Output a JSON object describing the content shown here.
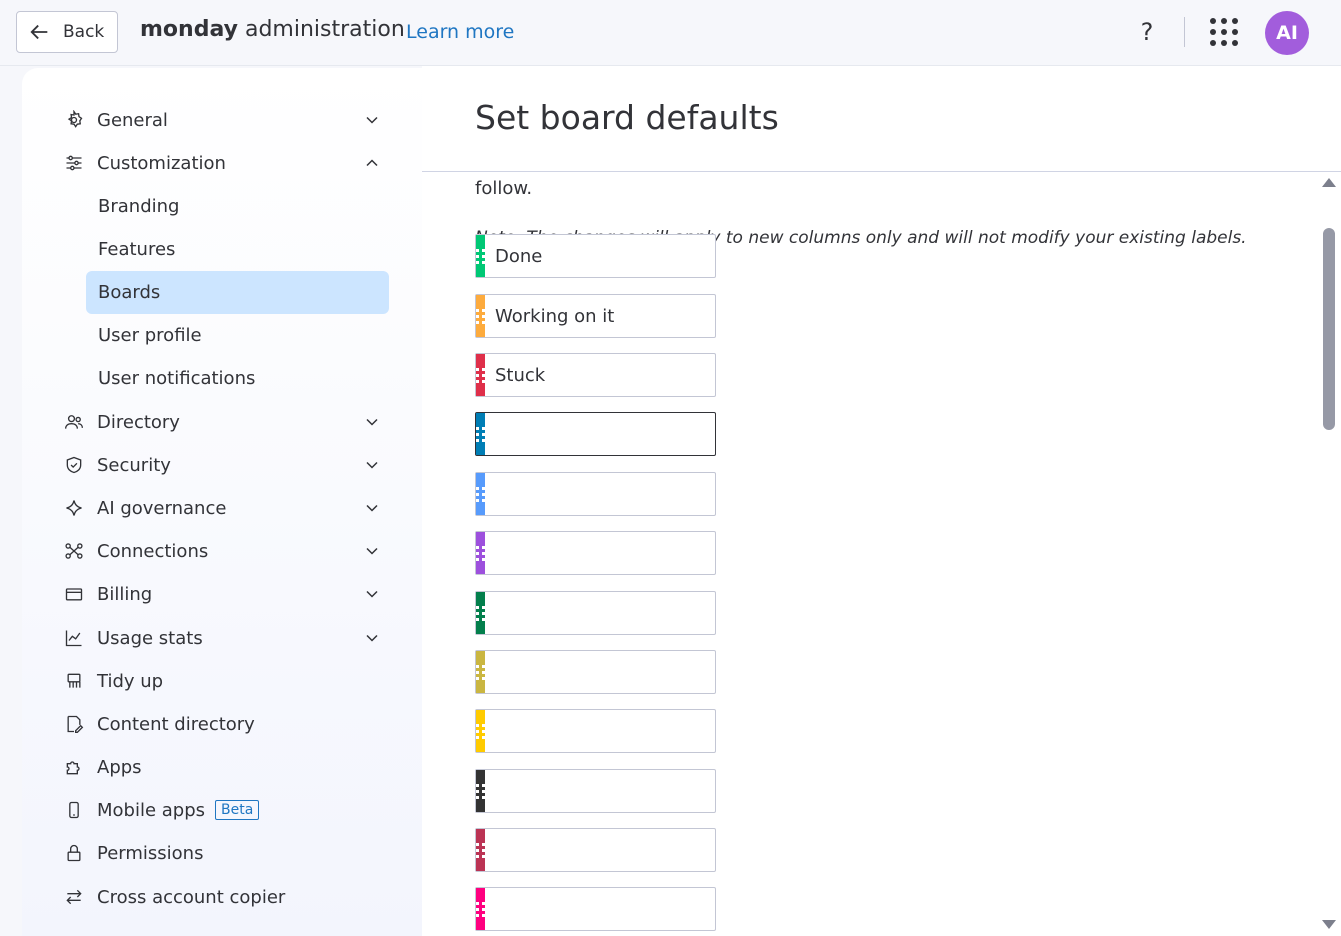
{
  "topbar": {
    "back_label": "Back",
    "brand_bold": "monday",
    "brand_rest": "administration",
    "learn_more": "Learn more",
    "help": "?",
    "avatar_initials": "AI",
    "avatar_color": "#a25ddc"
  },
  "sidebar": {
    "general": "General",
    "customization": "Customization",
    "branding": "Branding",
    "features": "Features",
    "boards": "Boards",
    "user_profile": "User profile",
    "user_notifications": "User notifications",
    "directory": "Directory",
    "security": "Security",
    "ai_governance": "AI governance",
    "connections": "Connections",
    "billing": "Billing",
    "usage_stats": "Usage stats",
    "tidy_up": "Tidy up",
    "content_directory": "Content directory",
    "apps": "Apps",
    "mobile_apps": "Mobile apps",
    "beta": "Beta",
    "permissions": "Permissions",
    "cross_account_copier": "Cross account copier"
  },
  "main": {
    "title": "Set board defaults",
    "desc_tail": "follow.",
    "note": "Note: The changes will apply to new columns only and will not modify your existing labels.",
    "labels": [
      {
        "value": "Done",
        "color": "#00c875"
      },
      {
        "value": "Working on it",
        "color": "#fdab3d"
      },
      {
        "value": "Stuck",
        "color": "#df2f4a"
      },
      {
        "value": "",
        "color": "#007eb5"
      },
      {
        "value": "",
        "color": "#579bfc"
      },
      {
        "value": "",
        "color": "#9d50dd"
      },
      {
        "value": "",
        "color": "#037f4c"
      },
      {
        "value": "",
        "color": "#cab641"
      },
      {
        "value": "",
        "color": "#ffcb00"
      },
      {
        "value": "",
        "color": "#333333"
      },
      {
        "value": "",
        "color": "#bb3354"
      },
      {
        "value": "",
        "color": "#ff007f"
      }
    ]
  }
}
